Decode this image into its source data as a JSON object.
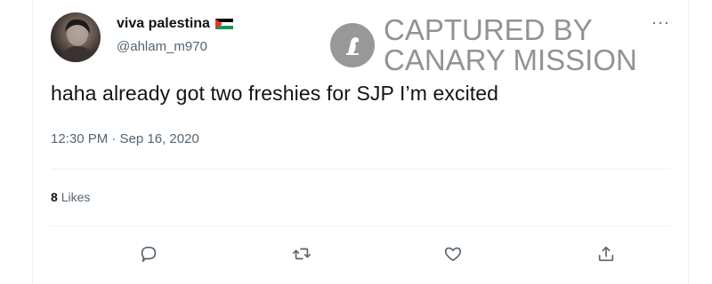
{
  "author": {
    "name": "viva palestina",
    "handle": "@ahlam_m970",
    "flag_icon": "palestine-flag-icon"
  },
  "watermark": {
    "line1": "CAPTURED BY",
    "line2": "CANARY MISSION",
    "logo_icon": "canary-bird-icon"
  },
  "tweet": {
    "text": "haha already got two freshies for SJP I’m excited",
    "timestamp": "12:30 PM · Sep 16, 2020"
  },
  "stats": {
    "likes_count": "8",
    "likes_label": "Likes"
  },
  "actions": {
    "reply_icon": "reply-icon",
    "retweet_icon": "retweet-icon",
    "like_icon": "heart-icon",
    "share_icon": "share-icon"
  },
  "colors": {
    "text_primary": "#0f1419",
    "text_secondary": "#536471",
    "divider": "#eff3f4"
  }
}
